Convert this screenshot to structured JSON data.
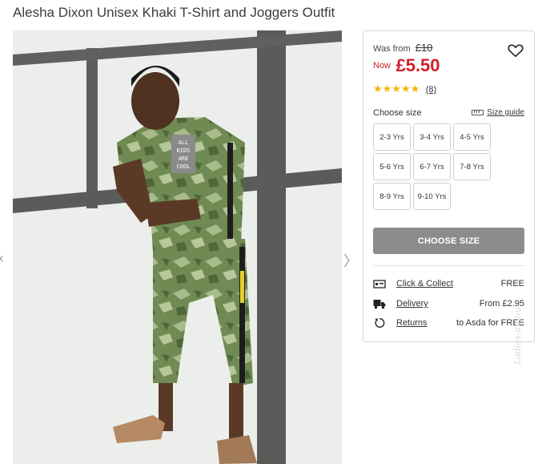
{
  "product": {
    "title": "Alesha Dixon Unisex Khaki T-Shirt and Joggers Outfit"
  },
  "gallery": {
    "prev_icon": "chevron-left-icon",
    "next_icon": "chevron-right-icon",
    "prev_glyph": "‹",
    "next_glyph": "〉",
    "tshirt_print": [
      "ALL",
      "KIDS",
      "ARE",
      "COOL"
    ]
  },
  "pricing": {
    "was_label": "Was from",
    "was_price": "£10",
    "now_label": "Now",
    "now_price": "£5.50",
    "price_color": "#d21f2b"
  },
  "wishlist": {
    "icon": "heart-icon"
  },
  "rating": {
    "stars_display": "★★★★★",
    "stars": 4.5,
    "review_count": "(8)",
    "star_color": "#f2b700"
  },
  "size": {
    "label": "Choose size",
    "guide_label": "Size guide",
    "guide_icon": "ruler-icon",
    "options": [
      "2-3 Yrs",
      "3-4 Yrs",
      "4-5 Yrs",
      "5-6 Yrs",
      "6-7 Yrs",
      "7-8 Yrs",
      "8-9 Yrs",
      "9-10 Yrs"
    ]
  },
  "cta": {
    "label": "CHOOSE SIZE",
    "color": "#8c8c8c"
  },
  "delivery": [
    {
      "icon": "click-collect-icon",
      "label": "Click & Collect",
      "value": "FREE"
    },
    {
      "icon": "delivery-truck-icon",
      "label": "Delivery",
      "value": "From £2.95"
    },
    {
      "icon": "returns-icon",
      "label": "Returns",
      "value": "to Asda for FREE"
    }
  ],
  "watermark": {
    "text": "Ladies-ap.uu"
  }
}
